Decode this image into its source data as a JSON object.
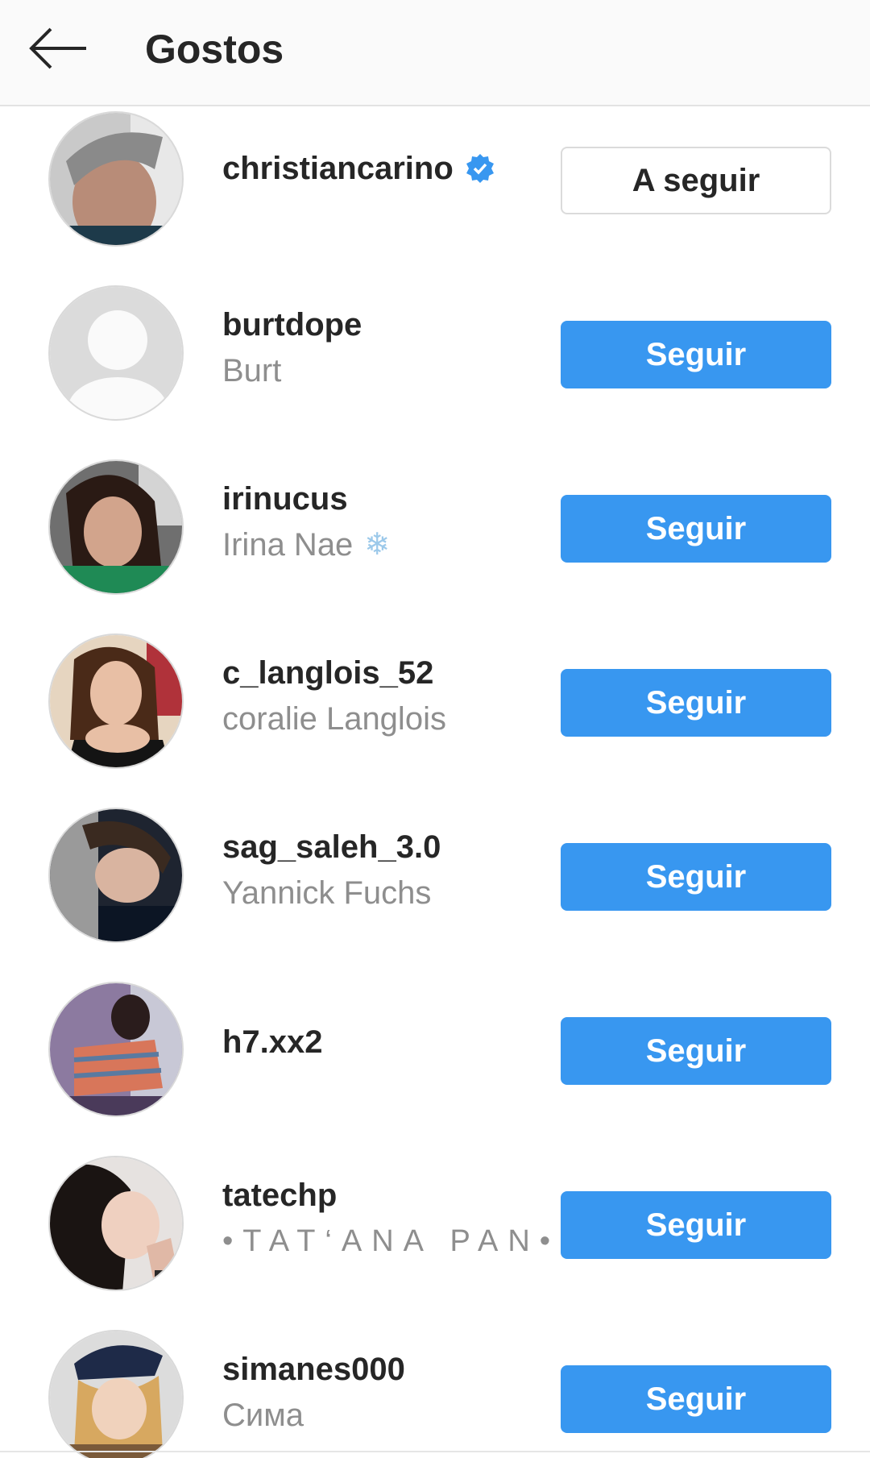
{
  "header": {
    "title": "Gostos",
    "back_icon": "arrow-left-icon"
  },
  "colors": {
    "accent": "#3897f0",
    "verified": "#3897f0",
    "muted_text": "#8e8e8e"
  },
  "users": [
    {
      "username": "christiancarino",
      "full_name": "",
      "verified": true,
      "button": "A seguir",
      "button_style": "following",
      "avatar": "photo"
    },
    {
      "username": "burtdope",
      "full_name": "Burt",
      "verified": false,
      "button": "Seguir",
      "button_style": "follow",
      "avatar": "default-silhouette"
    },
    {
      "username": "irinucus",
      "full_name": "Irina Nae",
      "emoji": "❄",
      "verified": false,
      "button": "Seguir",
      "button_style": "follow",
      "avatar": "photo"
    },
    {
      "username": "c_langlois_52",
      "full_name": "coralie Langlois",
      "verified": false,
      "button": "Seguir",
      "button_style": "follow",
      "avatar": "photo"
    },
    {
      "username": "sag_saleh_3.0",
      "full_name": "Yannick Fuchs",
      "verified": false,
      "button": "Seguir",
      "button_style": "follow",
      "avatar": "photo"
    },
    {
      "username": "h7.xx2",
      "full_name": "",
      "verified": false,
      "button": "Seguir",
      "button_style": "follow",
      "avatar": "photo"
    },
    {
      "username": "tatechp",
      "full_name": "•TAT‘ANA PAN•",
      "verified": false,
      "button": "Seguir",
      "button_style": "follow",
      "avatar": "photo"
    },
    {
      "username": "simanes000",
      "full_name": "Сима",
      "verified": false,
      "button": "Seguir",
      "button_style": "follow",
      "avatar": "photo"
    }
  ]
}
